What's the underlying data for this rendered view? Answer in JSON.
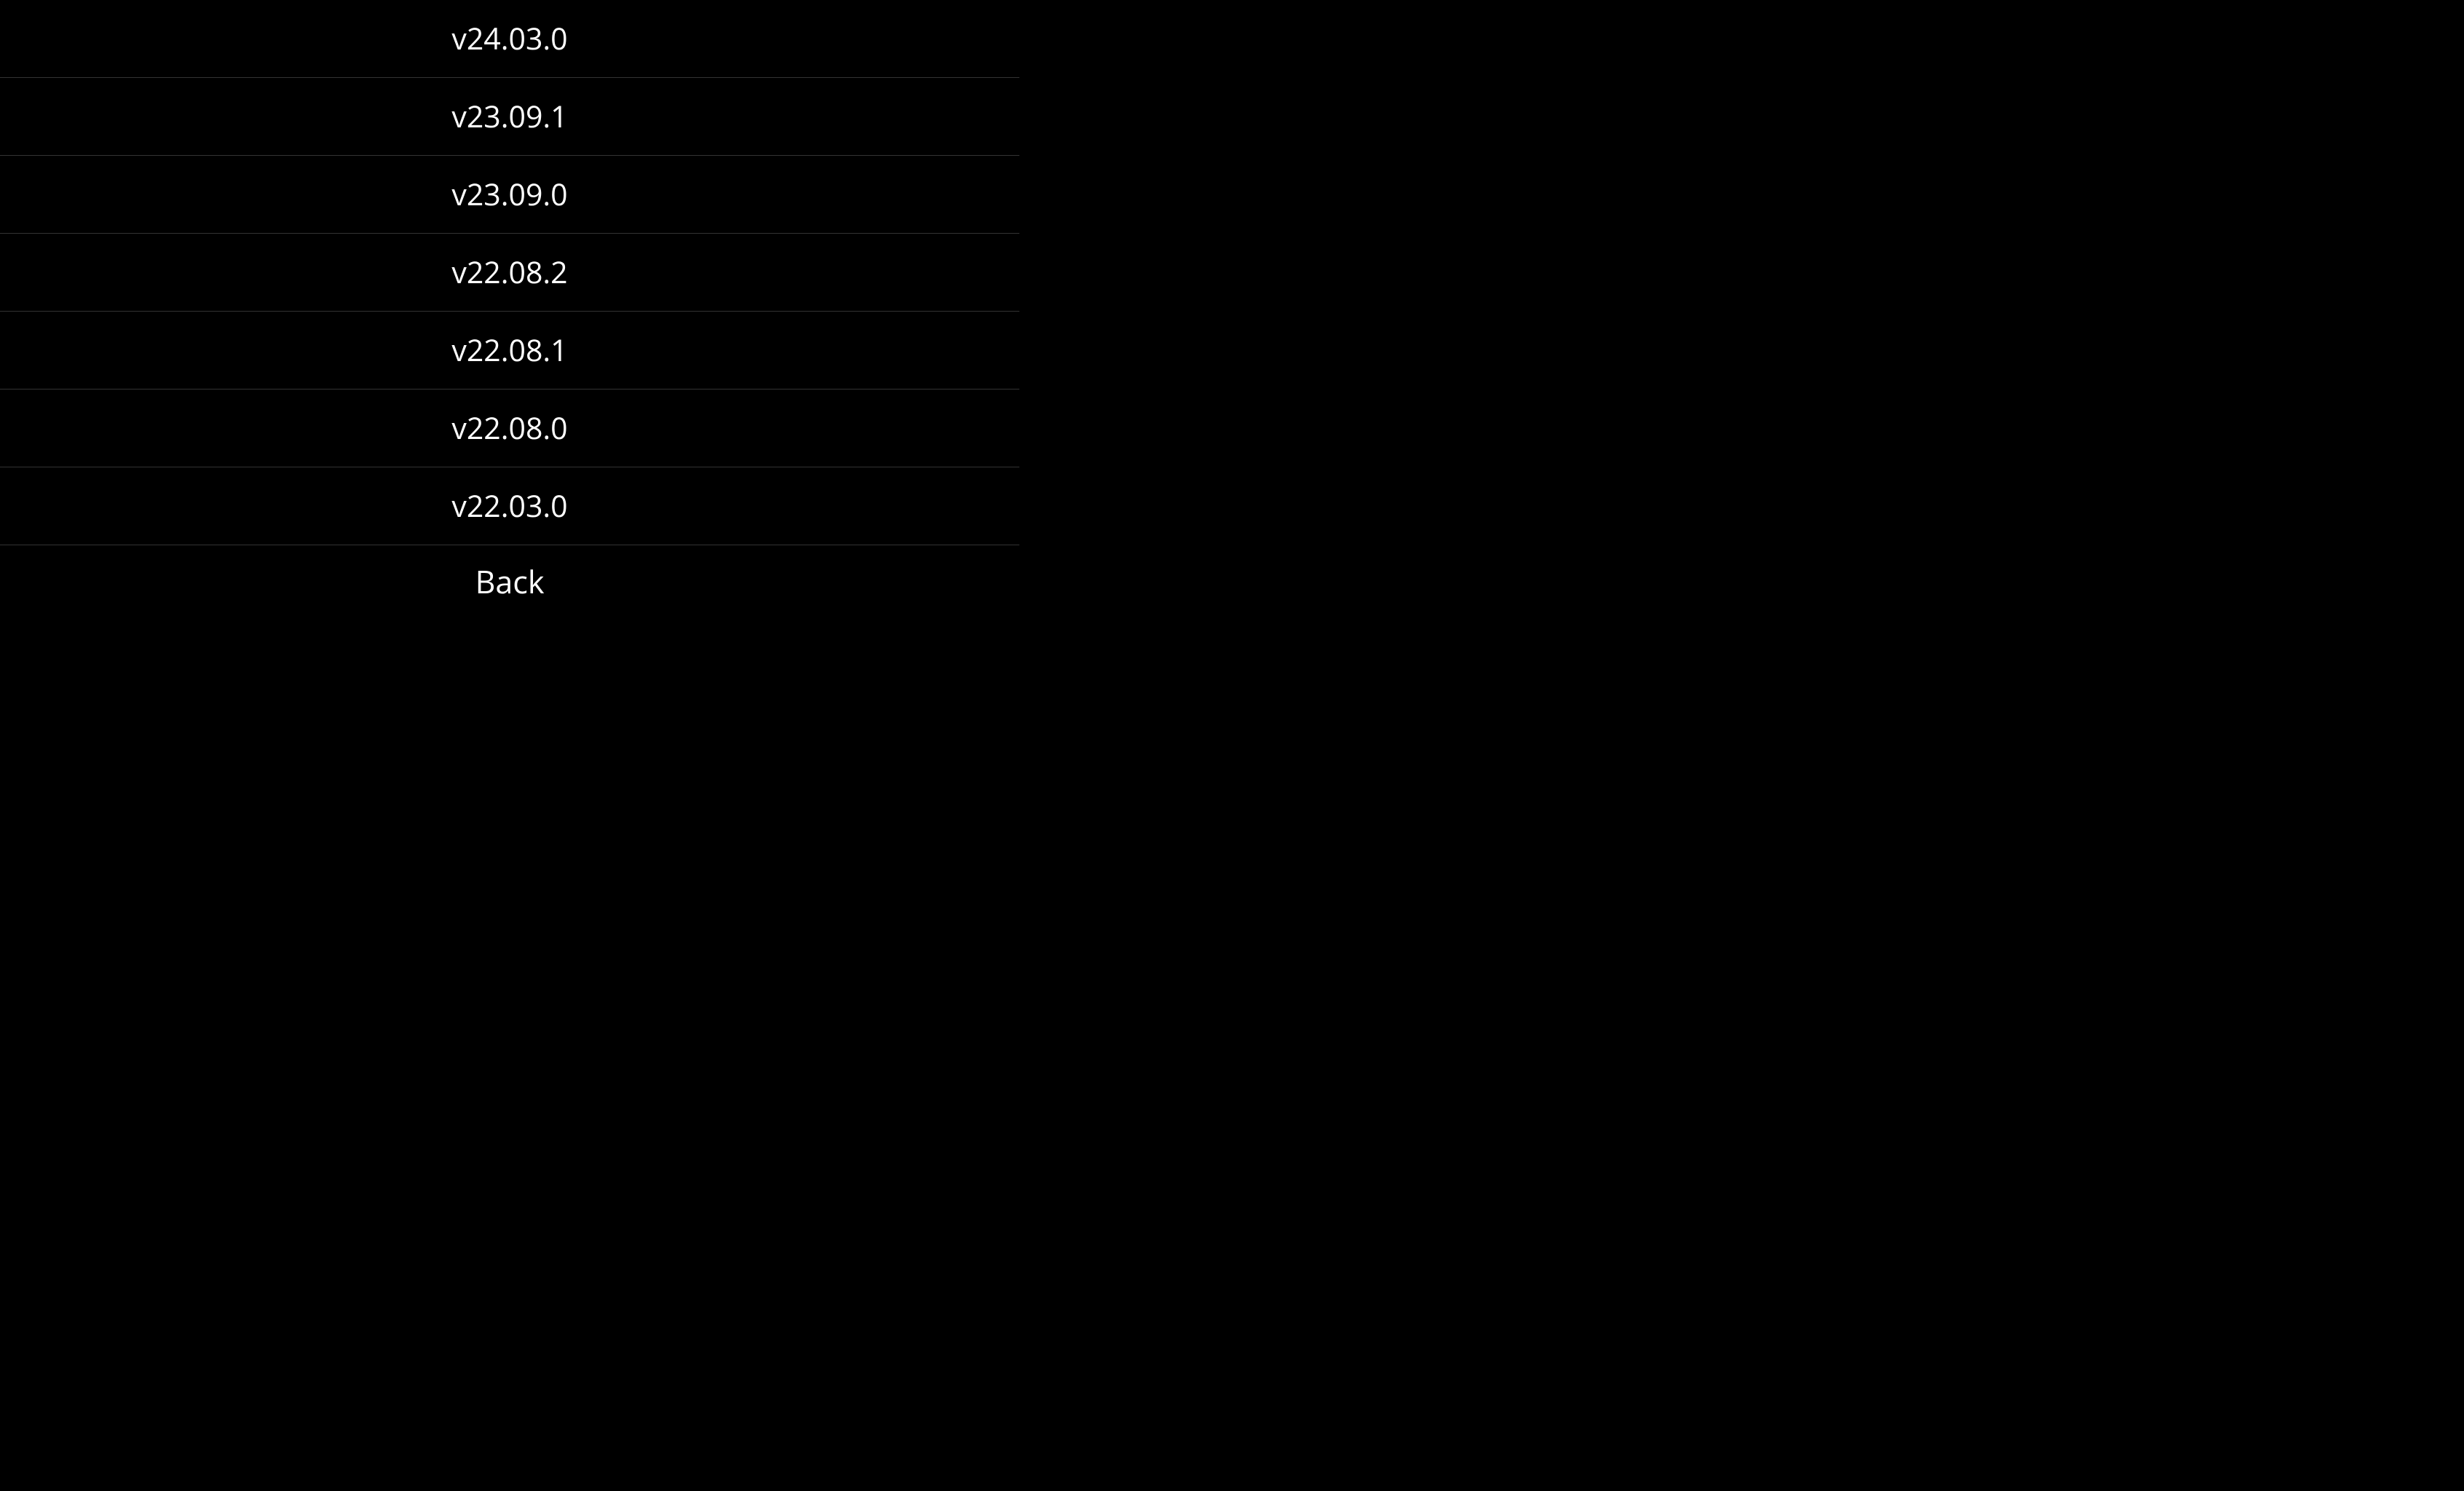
{
  "menu": {
    "items": [
      {
        "label": "v24.03.0"
      },
      {
        "label": "v23.09.1"
      },
      {
        "label": "v23.09.0"
      },
      {
        "label": "v22.08.2"
      },
      {
        "label": "v22.08.1"
      },
      {
        "label": "v22.08.0"
      },
      {
        "label": "v22.03.0"
      }
    ],
    "back_label": "Back"
  }
}
